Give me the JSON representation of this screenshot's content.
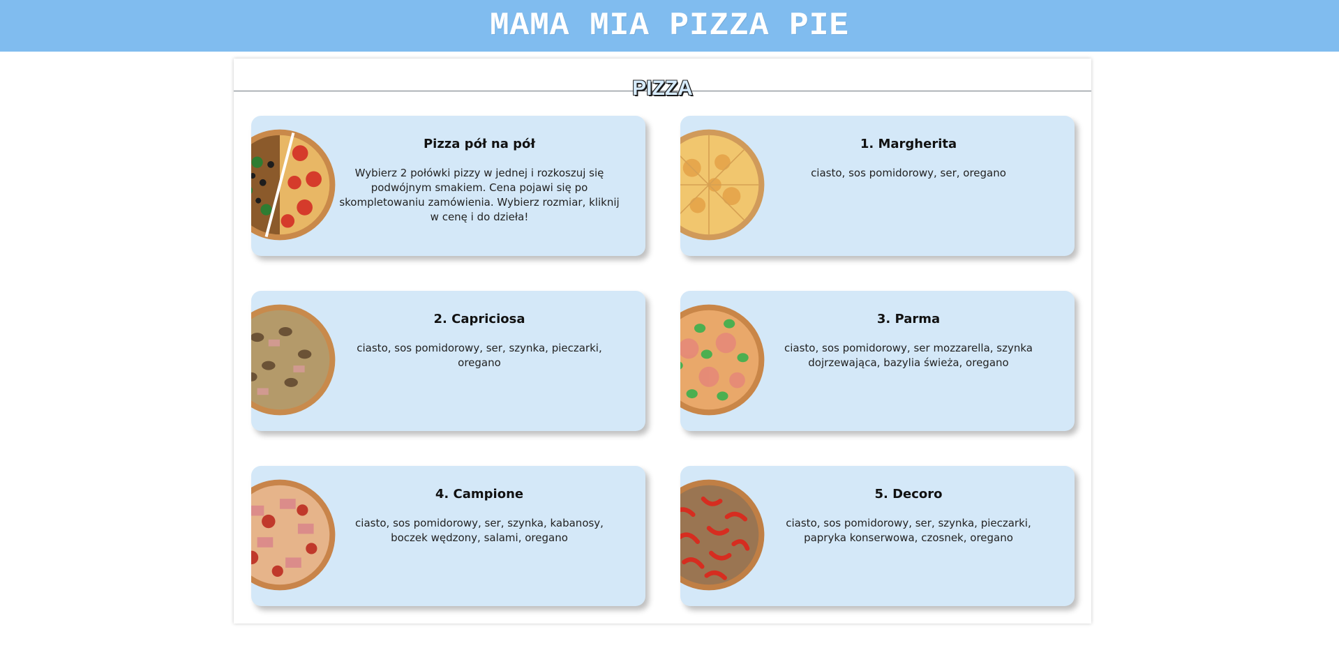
{
  "header": {
    "title": "MAMA MIA PIZZA PIE"
  },
  "section": {
    "title": "PIZZA"
  },
  "items": [
    {
      "title": "Pizza pół na pół",
      "description": "Wybierz 2 połówki pizzy w jednej i rozkoszuj się podwójnym smakiem. Cena pojawi się po skompletowaniu zamówienia. Wybierz rozmiar, kliknij w cenę i do dzieła!",
      "image": "half-and-half-pizza-image"
    },
    {
      "title": "1. Margherita",
      "description": "ciasto, sos pomidorowy, ser, oregano",
      "image": "margherita-pizza-image"
    },
    {
      "title": "2. Capriciosa",
      "description": "ciasto, sos pomidorowy, ser, szynka, pieczarki, oregano",
      "image": "capriciosa-pizza-image"
    },
    {
      "title": "3. Parma",
      "description": "ciasto, sos pomidorowy, ser mozzarella, szynka dojrzewająca, bazylia świeża, oregano",
      "image": "parma-pizza-image"
    },
    {
      "title": "4. Campione",
      "description": "ciasto, sos pomidorowy, ser, szynka, kabanosy, boczek wędzony, salami, oregano",
      "image": "campione-pizza-image"
    },
    {
      "title": "5. Decoro",
      "description": "ciasto, sos pomidorowy, ser, szynka, pieczarki, papryka konserwowa, czosnek, oregano",
      "image": "decoro-pizza-image"
    }
  ],
  "colors": {
    "header_bg": "#80bcef",
    "card_bg": "#d4e8f8"
  }
}
